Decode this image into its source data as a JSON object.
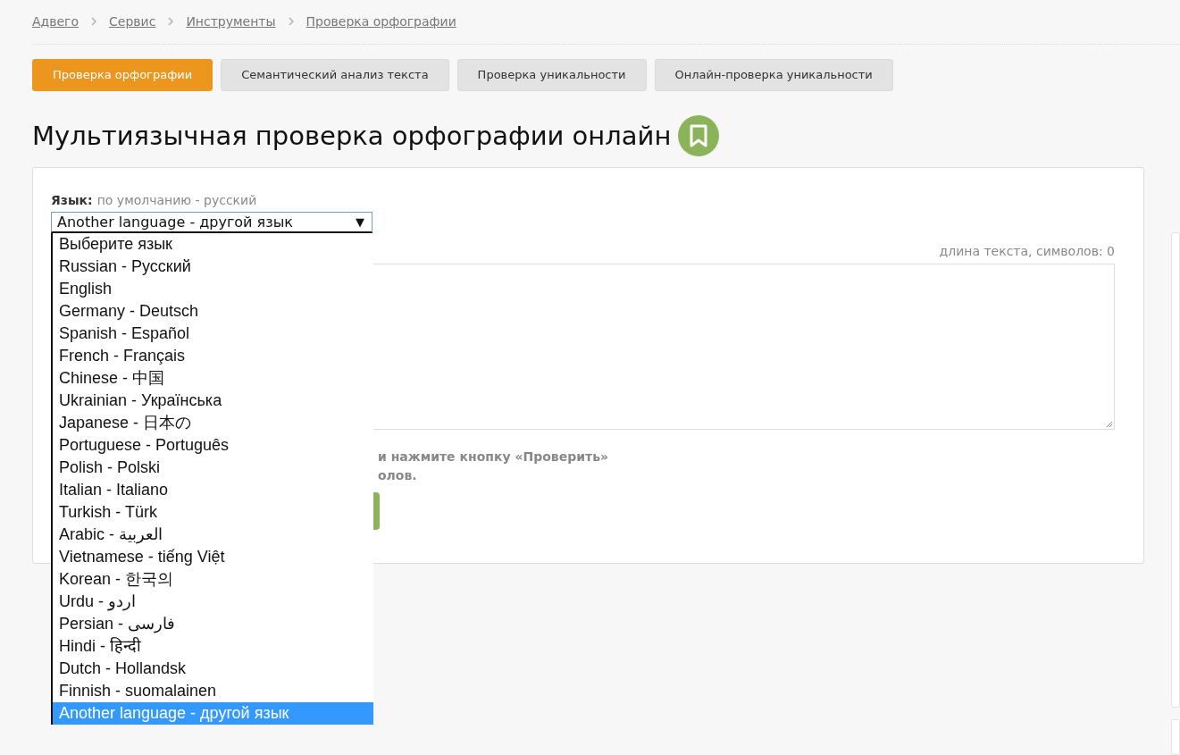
{
  "breadcrumbs": [
    "Адвего",
    "Сервис",
    "Инструменты",
    "Проверка орфографии"
  ],
  "tabs": [
    {
      "label": "Проверка орфографии",
      "selected": true
    },
    {
      "label": "Семантический анализ текста",
      "selected": false
    },
    {
      "label": "Проверка уникальности",
      "selected": false
    },
    {
      "label": "Онлайн-проверка уникальности",
      "selected": false
    }
  ],
  "title": "Мультиязычная проверка орфографии онлайн",
  "language": {
    "label": "Язык:",
    "hint": "по умолчанию - русский",
    "value": "Another language - другой язык",
    "caret": "▼",
    "expanded": true,
    "options": [
      {
        "label": "Выберите язык",
        "selected": false
      },
      {
        "label": "Russian - Русский",
        "selected": false
      },
      {
        "label": "English",
        "selected": false
      },
      {
        "label": "Germany - Deutsch",
        "selected": false
      },
      {
        "label": "Spanish - Español",
        "selected": false
      },
      {
        "label": "French - Français",
        "selected": false
      },
      {
        "label": "Chinese - 中国",
        "selected": false
      },
      {
        "label": "Ukrainian - Українська",
        "selected": false
      },
      {
        "label": "Japanese - 日本の",
        "selected": false
      },
      {
        "label": "Portuguese - Português",
        "selected": false
      },
      {
        "label": "Polish - Polski",
        "selected": false
      },
      {
        "label": "Italian - Italiano",
        "selected": false
      },
      {
        "label": "Turkish - Türk",
        "selected": false
      },
      {
        "label": "Arabic - العربية",
        "selected": false
      },
      {
        "label": "Vietnamese - tiếng Việt",
        "selected": false
      },
      {
        "label": "Korean - 한국의",
        "selected": false
      },
      {
        "label": "Urdu - اردو",
        "selected": false
      },
      {
        "label": "Persian - فارسی",
        "selected": false
      },
      {
        "label": "Hindi - हिन्दी",
        "selected": false
      },
      {
        "label": "Dutch - Hollandsk",
        "selected": false
      },
      {
        "label": "Finnish - suomalainen",
        "selected": false
      },
      {
        "label": "Another language - другой язык",
        "selected": true
      }
    ]
  },
  "counter": "длина текста, символов: 0",
  "hint_lines": [
    "и нажмите кнопку «Проверить»",
    "олов."
  ]
}
